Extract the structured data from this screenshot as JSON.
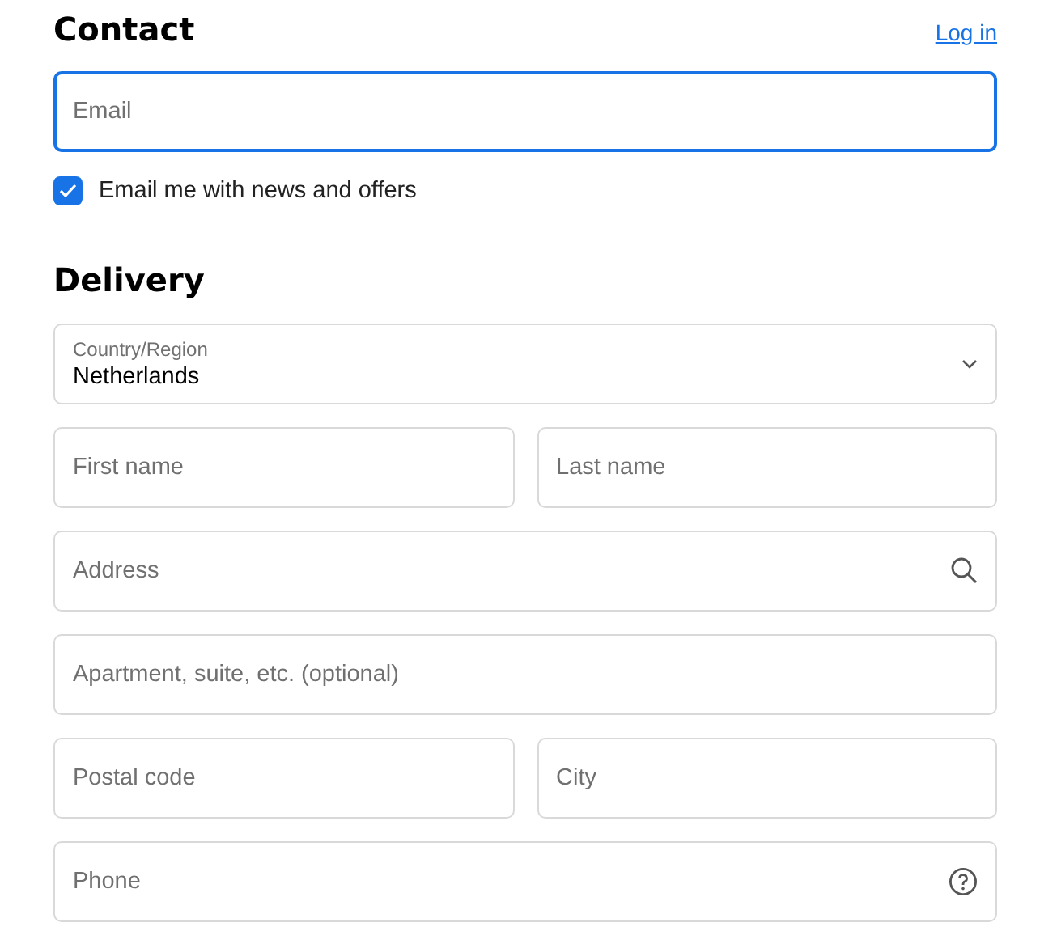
{
  "contact": {
    "title": "Contact",
    "login_link": "Log in",
    "email": {
      "placeholder": "Email",
      "focused": true
    },
    "newsletter": {
      "label": "Email me with news and offers",
      "checked": true
    }
  },
  "delivery": {
    "title": "Delivery",
    "rows": [
      {
        "fields": [
          {
            "kind": "select",
            "label": "Country/Region",
            "value": "Netherlands"
          }
        ]
      },
      {
        "fields": [
          {
            "kind": "text",
            "placeholder": "First name"
          },
          {
            "kind": "text",
            "placeholder": "Last name"
          }
        ]
      },
      {
        "fields": [
          {
            "kind": "search",
            "placeholder": "Address"
          }
        ]
      },
      {
        "fields": [
          {
            "kind": "text",
            "placeholder": "Apartment, suite, etc. (optional)"
          }
        ]
      },
      {
        "fields": [
          {
            "kind": "text",
            "placeholder": "Postal code"
          },
          {
            "kind": "text",
            "placeholder": "City"
          }
        ]
      },
      {
        "fields": [
          {
            "kind": "help",
            "placeholder": "Phone"
          }
        ]
      }
    ]
  }
}
